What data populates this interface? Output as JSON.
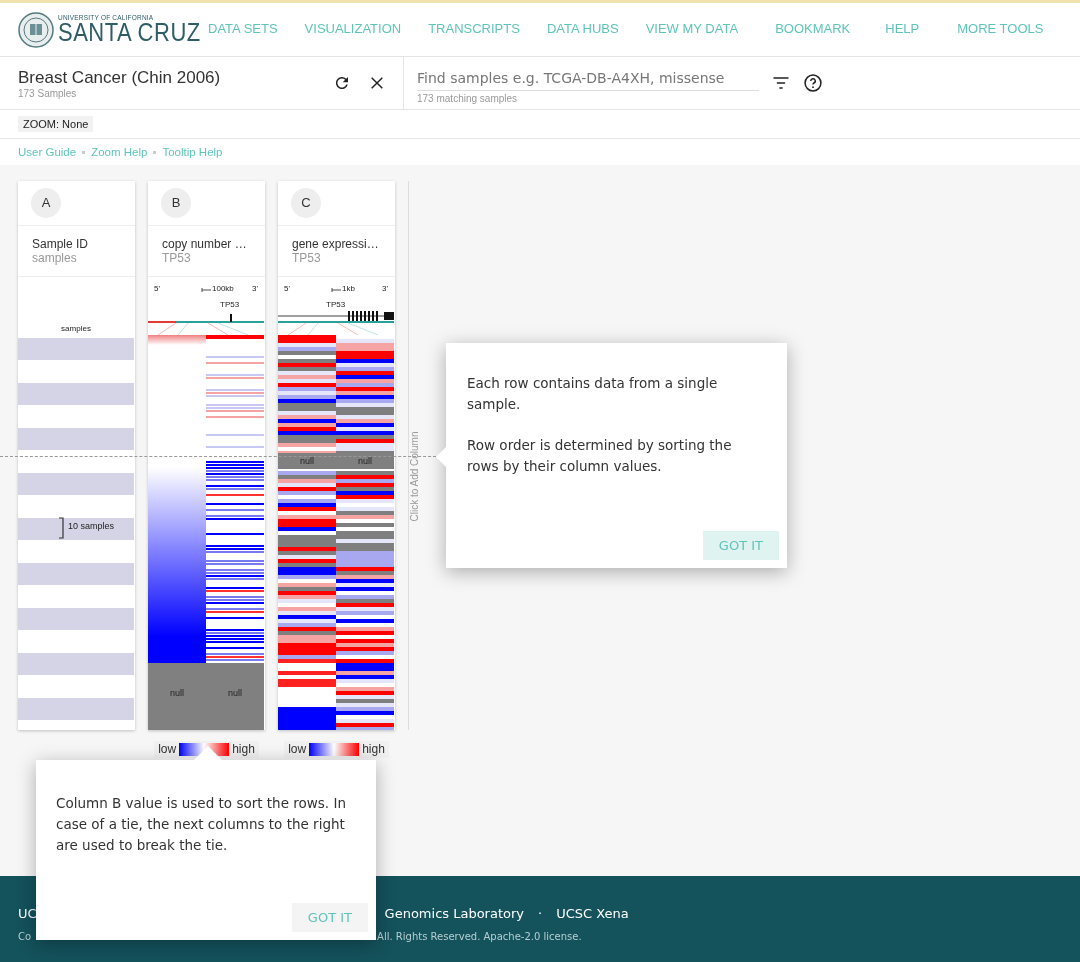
{
  "header": {
    "logo_top": "UNIVERSITY OF CALIFORNIA",
    "logo_main": "SANTA CRUZ",
    "nav": [
      "DATA SETS",
      "VISUALIZATION",
      "TRANSCRIPTS",
      "DATA HUBS",
      "VIEW MY DATA",
      "BOOKMARK",
      "HELP",
      "MORE TOOLS"
    ]
  },
  "cohort": {
    "title": "Breast Cancer (Chin 2006)",
    "subtitle": "173 Samples"
  },
  "search": {
    "placeholder": "Find samples e.g. TCGA-DB-A4XH, missense",
    "hint": "173 matching samples"
  },
  "zoom": "ZOOM: None",
  "help_links": [
    "User Guide",
    "Zoom Help",
    "Tooltip Help"
  ],
  "columns": [
    {
      "kind": "samples",
      "letter": "A",
      "title": "Sample ID",
      "subtitle": "samples",
      "track_label": "samples",
      "group_label": "10 samples"
    },
    {
      "kind": "copy_number",
      "letter": "B",
      "title": "copy number …",
      "subtitle": "TP53",
      "left_end": "5'",
      "right_end": "3'",
      "scale": "100kb",
      "gene": "TP53",
      "null_labels": [
        "null",
        "null"
      ],
      "legend": {
        "low": "low",
        "high": "high"
      }
    },
    {
      "kind": "gene_expression",
      "letter": "C",
      "title": "gene expressi…",
      "subtitle": "TP53",
      "left_end": "5'",
      "right_end": "3'",
      "scale": "1kb",
      "gene": "TP53",
      "null_labels": [
        "null",
        "null"
      ],
      "legend": {
        "low": "low",
        "high": "high"
      }
    }
  ],
  "add_column": "Click to Add Column",
  "tooltips": [
    {
      "paragraphs": [
        "Each row contains data from a single sample.",
        "Row order is determined by sorting the rows by their column values."
      ],
      "button": "GOT IT"
    },
    {
      "paragraphs": [
        "Column B value is used to sort the rows. In case of a tie, the next columns to the right are used to break the tie."
      ],
      "button": "GOT IT"
    }
  ],
  "footer": {
    "title_start": "UC",
    "lab": "Genomics Laboratory",
    "separator": "·",
    "product": "UCSC Xena",
    "copyright_start": "Co",
    "copyright_end": "All. Rights Reserved. Apache-2.0 license."
  }
}
